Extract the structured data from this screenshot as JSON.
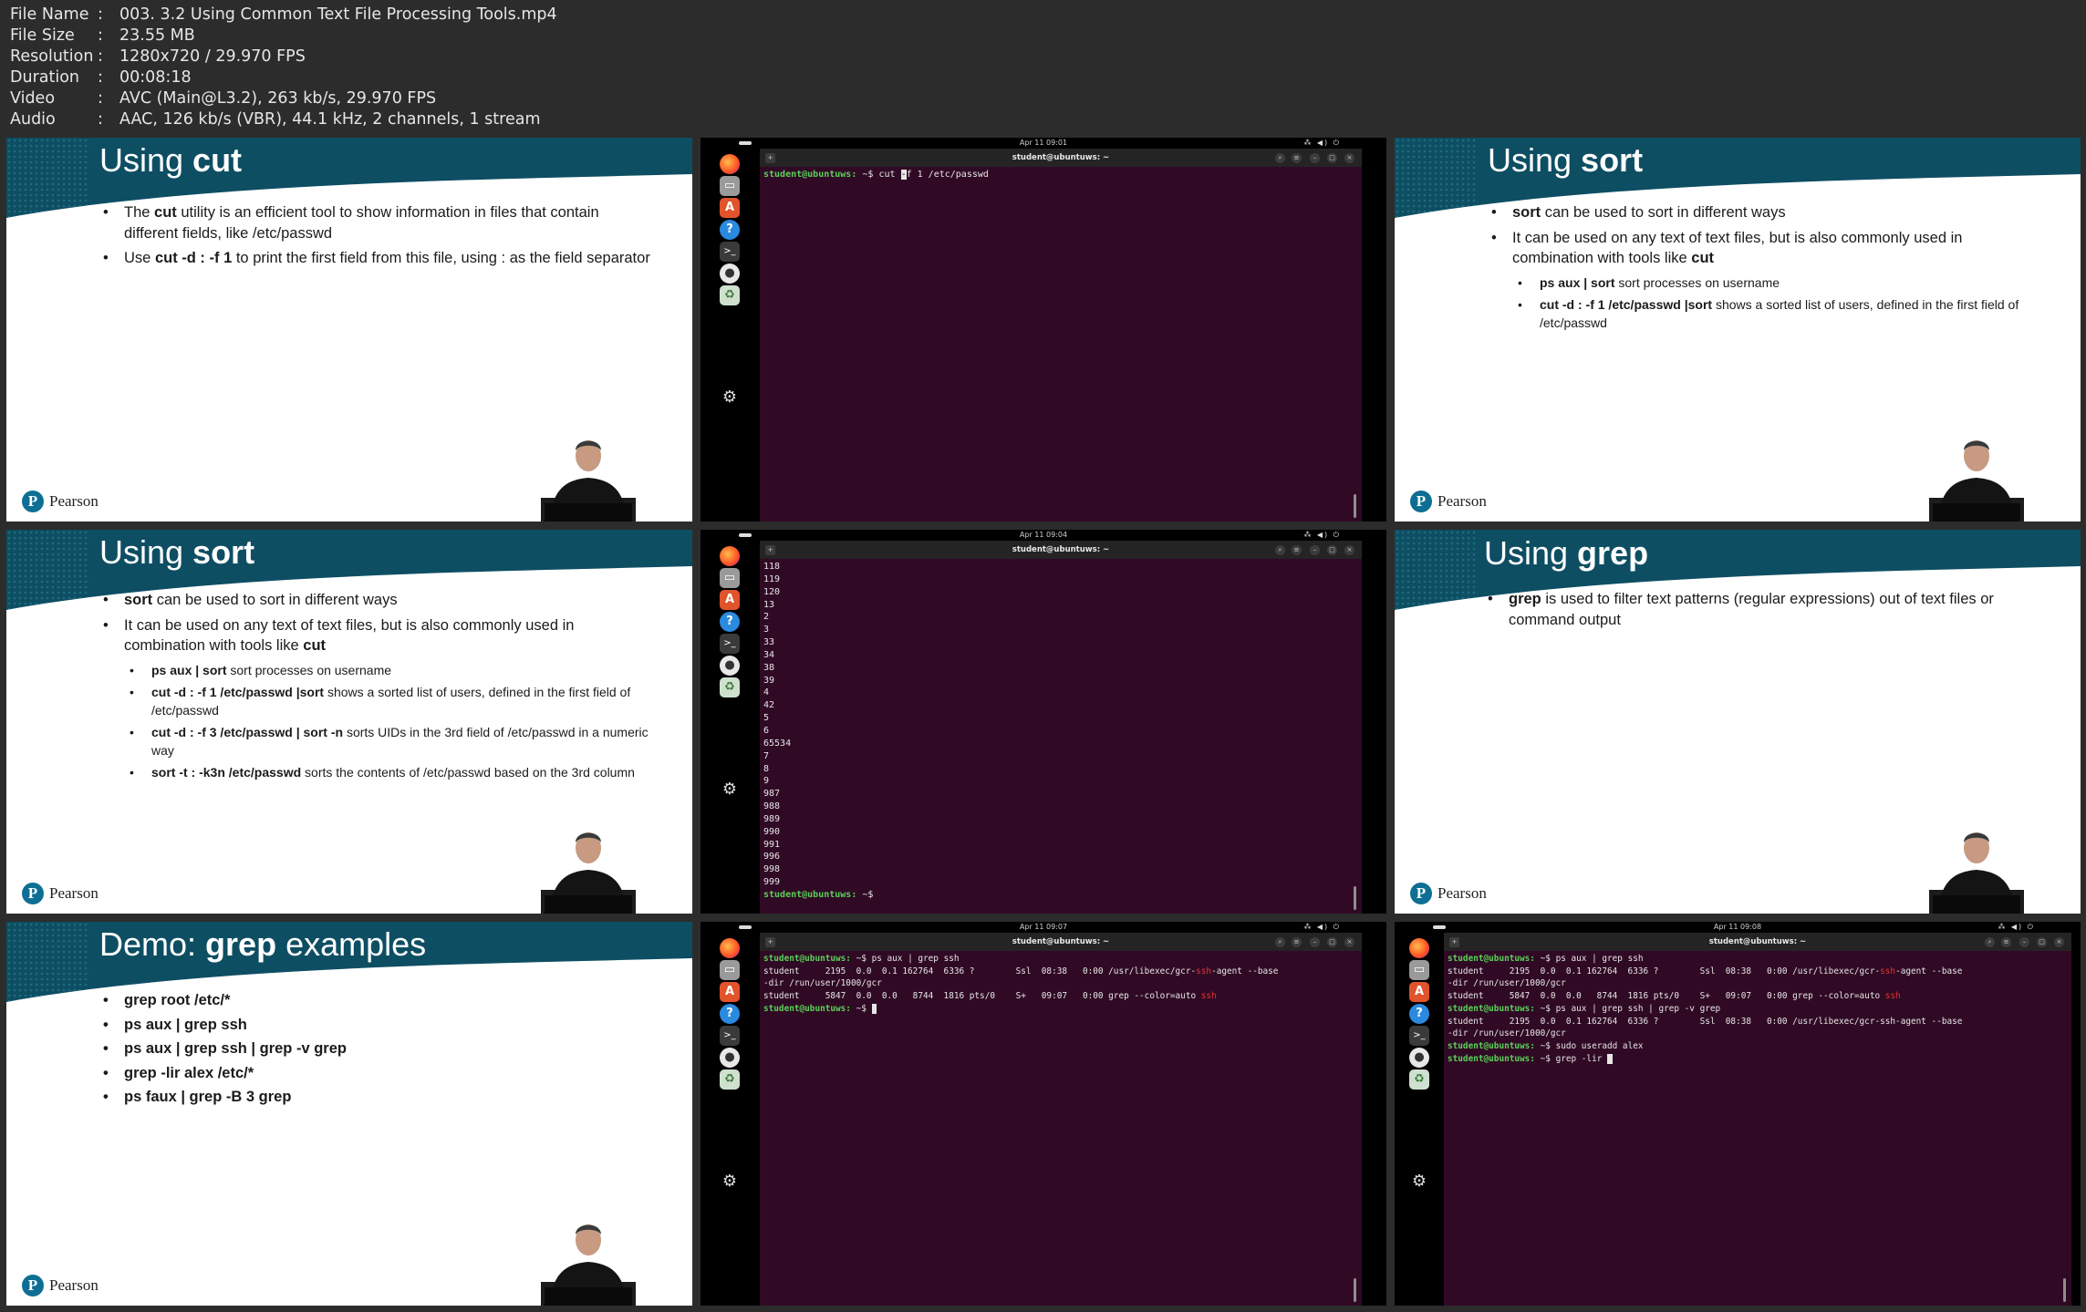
{
  "info": [
    {
      "key": "File Name",
      "value": "003. 3.2 Using Common Text File Processing Tools.mp4"
    },
    {
      "key": "File Size",
      "value": "23.55 MB"
    },
    {
      "key": "Resolution",
      "value": "1280x720 / 29.970 FPS"
    },
    {
      "key": "Duration",
      "value": "00:08:18"
    },
    {
      "key": "Video",
      "value": "AVC (Main@L3.2), 263 kb/s, 29.970 FPS"
    },
    {
      "key": "Audio",
      "value": "AAC, 126 kb/s (VBR), 44.1 kHz, 2 channels, 1 stream"
    }
  ],
  "brand": {
    "name": "Pearson",
    "logo_letter": "P"
  },
  "colors": {
    "header": "#0e4e63",
    "header_dots": "#1d6c82",
    "terminal_bg": "#300a24",
    "prompt": "#5ad15a",
    "match": "#e63333"
  },
  "slides": {
    "cut": {
      "title_prefix": "Using ",
      "title_bold": "cut",
      "b1_pre": "The ",
      "b1_bold": "cut",
      "b1_post": " utility is an efficient tool to show information in files that contain different fields, like /etc/passwd",
      "b2_pre": "Use ",
      "b2_bold": "cut -d : -f 1",
      "b2_post": " to print the first field from this file, using : as the field separator"
    },
    "sort": {
      "title_prefix": "Using ",
      "title_bold": "sort",
      "b1_bold": "sort",
      "b1_post": " can be used to sort in different ways",
      "b2_pre": "It can be used on any text of text files, but is also commonly used in combination with tools like ",
      "b2_bold": "cut",
      "s1_bold": "ps aux | sort",
      "s1_post": " sort processes on username",
      "s2_bold": "cut -d : -f 1 /etc/passwd |sort",
      "s2_post": " shows a sorted list of users, defined in the first field of /etc/passwd",
      "s3_bold": "cut -d : -f 3 /etc/passwd | sort -n",
      "s3_post": " sorts UIDs in the 3rd field of /etc/passwd in a numeric way",
      "s4_bold": "sort -t : -k3n /etc/passwd",
      "s4_post": " sorts the contents of /etc/passwd based on the 3rd column"
    },
    "grep": {
      "title_prefix": "Using ",
      "title_bold": "grep",
      "b1_bold": "grep",
      "b1_post": " is used to filter text patterns (regular expressions) out of text files or command output"
    },
    "demo": {
      "title_prefix": "Demo: ",
      "title_bold": "grep",
      "title_suffix": " examples",
      "items": [
        "grep root /etc/*",
        "ps aux | grep ssh",
        "ps aux | grep ssh | grep -v grep",
        "grep -lir alex /etc/*",
        "ps faux | grep -B 3 grep"
      ]
    }
  },
  "terminals": {
    "window_title": "student@ubuntuws: ~",
    "prompt": "student@ubuntuws:",
    "prompt_tail": "~$",
    "tray": "⁂ ◀) ⏻",
    "t1": {
      "clock": "Apr 11 09:01",
      "cmd_a": "cut ",
      "cmd_cursor": "-",
      "cmd_b": "f 1 /etc/passwd"
    },
    "t2": {
      "clock": "Apr 11 09:04",
      "lines": [
        "118",
        "119",
        "120",
        "13",
        "2",
        "3",
        "33",
        "34",
        "38",
        "39",
        "4",
        "42",
        "5",
        "6",
        "65534",
        "7",
        "8",
        "9",
        "987",
        "988",
        "989",
        "990",
        "991",
        "996",
        "998",
        "999"
      ]
    },
    "t3": {
      "clock": "Apr 11 09:07",
      "cmd1": "ps aux | grep ssh",
      "r1_a": "student     2195  0.0  0.1 162764  6336 ?        Ssl  08:38   0:00 /usr/libexec/gcr-",
      "r1_hl": "ssh",
      "r1_b": "-agent --base",
      "r1_c": "-dir /run/user/1000/gcr",
      "r2_a": "student     5847  0.0  0.0   8744  1816 pts/0    S+   09:07   0:00 grep --color=auto ",
      "r2_hl": "ssh"
    },
    "t4": {
      "clock": "Apr 11 09:08",
      "cmd1": "ps aux | grep ssh",
      "r1_a": "student     2195  0.0  0.1 162764  6336 ?        Ssl  08:38   0:00 /usr/libexec/gcr-",
      "r1_hl": "ssh",
      "r1_b": "-agent --base",
      "r1_c": "-dir /run/user/1000/gcr",
      "r2_a": "student     5847  0.0  0.0   8744  1816 pts/0    S+   09:07   0:00 grep --color=auto ",
      "r2_hl": "ssh",
      "cmd2": "ps aux | grep ssh | grep -v grep",
      "r3_a": "student     2195  0.0  0.1 162764  6336 ?        Ssl  08:38   0:00 /usr/libexec/gcr-ssh-agent --base",
      "r3_b": "-dir /run/user/1000/gcr",
      "cmd3": "sudo useradd alex",
      "cmd4": "grep -lir "
    }
  }
}
